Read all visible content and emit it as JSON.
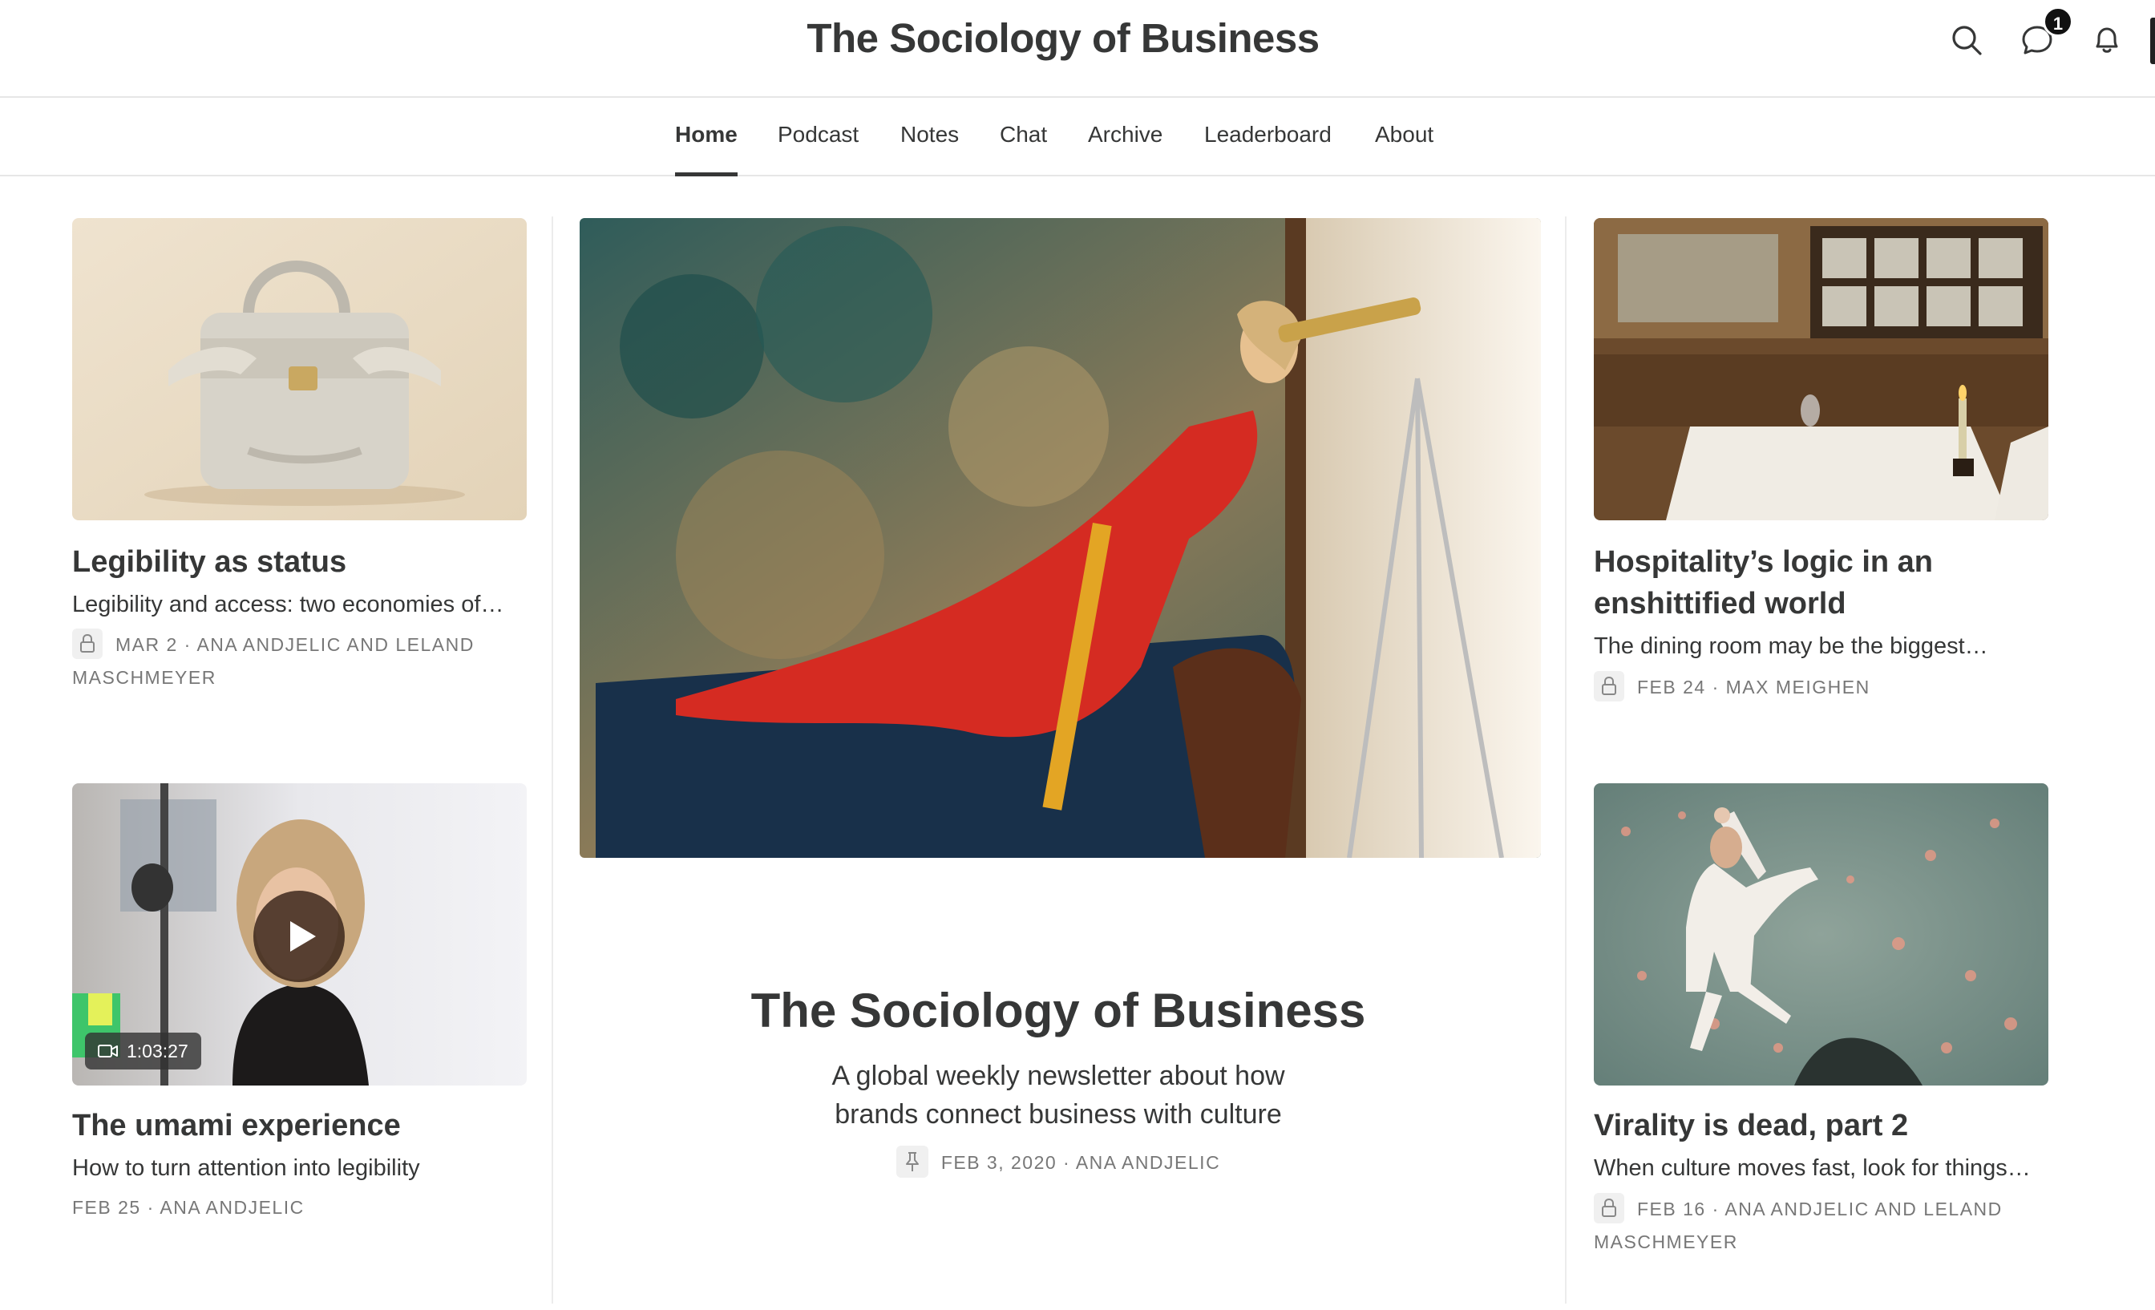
{
  "header": {
    "title": "The Sociology of Business",
    "message_badge": "1"
  },
  "nav": {
    "items": [
      "Home",
      "Podcast",
      "Notes",
      "Chat",
      "Archive",
      "Leaderboard",
      "About"
    ],
    "active": "Home"
  },
  "posts": {
    "legibility": {
      "title": "Legibility as status",
      "subtitle": "Legibility and access: two economies of…",
      "meta_line1": "MAR 2 · ANA ANDJELIC AND LELAND",
      "meta_line2": "MASCHMEYER"
    },
    "umami": {
      "title": "The umami experience",
      "subtitle": "How to turn attention into legibility",
      "meta": "FEB 25 · ANA ANDJELIC",
      "duration": "1:03:27"
    },
    "hospitality": {
      "title_line1": "Hospitality’s logic in an",
      "title_line2": "enshittified world",
      "subtitle": "The dining room may be the biggest…",
      "meta": "FEB 24 · MAX MEIGHEN"
    },
    "virality": {
      "title": "Virality is dead, part 2",
      "subtitle": "When culture moves fast, look for things…",
      "meta_line1": "FEB 16 · ANA ANDJELIC AND LELAND",
      "meta_line2": "MASCHMEYER"
    }
  },
  "featured": {
    "title": "The Sociology of Business",
    "subtitle_line1": "A global weekly newsletter about how",
    "subtitle_line2": "brands connect business with culture",
    "meta": "FEB 3, 2020 · ANA ANDJELIC"
  },
  "colors": {
    "text": "#363737",
    "meta": "#777777",
    "divider": "#e6e6e6"
  }
}
